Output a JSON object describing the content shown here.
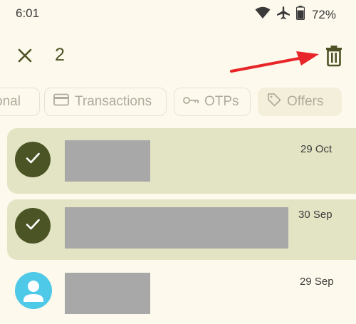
{
  "status_bar": {
    "time": "6:01",
    "battery": "72%"
  },
  "toolbar": {
    "selected_count": "2"
  },
  "filter_chips": [
    {
      "label": "onal"
    },
    {
      "label": "Transactions"
    },
    {
      "label": "OTPs"
    },
    {
      "label": "Offers"
    }
  ],
  "conversations": [
    {
      "date": "29 Oct",
      "selected": true
    },
    {
      "date": "30 Sep",
      "selected": true
    },
    {
      "date": "29 Sep",
      "selected": false
    }
  ],
  "colors": {
    "background": "#fdf9ec",
    "accent": "#4b5424",
    "selected_row": "#e3e4c4",
    "avatar_blue": "#4ec9e8",
    "annotation_arrow": "#e8262a"
  }
}
